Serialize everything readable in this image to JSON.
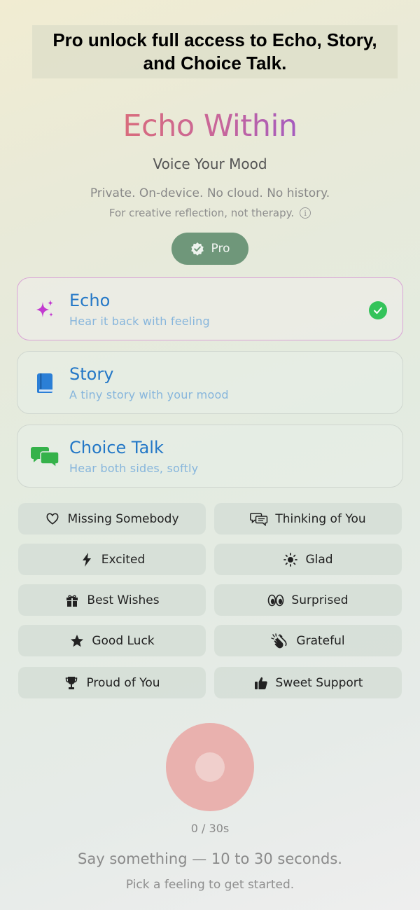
{
  "banner": {
    "text": "Pro unlock full access to Echo, Story, and Choice Talk."
  },
  "header": {
    "title": "Echo Within",
    "subtitle": "Voice Your Mood",
    "privacy": "Private. On-device. No cloud. No history.",
    "disclaimer": "For creative reflection, not therapy.",
    "pro_label": "Pro"
  },
  "modes": [
    {
      "title": "Echo",
      "description": "Hear it back with feeling",
      "icon": "sparkles-icon",
      "selected": true
    },
    {
      "title": "Story",
      "description": "A tiny story with your mood",
      "icon": "book-icon",
      "selected": false
    },
    {
      "title": "Choice Talk",
      "description": "Hear both sides, softly",
      "icon": "chat-bubbles-icon",
      "selected": false
    }
  ],
  "feelings": [
    {
      "label": "Missing Somebody",
      "icon": "heart-icon"
    },
    {
      "label": "Thinking of You",
      "icon": "message-bubbles-icon"
    },
    {
      "label": "Excited",
      "icon": "bolt-icon"
    },
    {
      "label": "Glad",
      "icon": "sun-icon"
    },
    {
      "label": "Best Wishes",
      "icon": "gift-icon"
    },
    {
      "label": "Surprised",
      "icon": "eyes-icon"
    },
    {
      "label": "Good Luck",
      "icon": "star-icon"
    },
    {
      "label": "Grateful",
      "icon": "hands-clap-icon"
    },
    {
      "label": "Proud of You",
      "icon": "trophy-icon"
    },
    {
      "label": "Sweet Support",
      "icon": "thumbs-up-icon"
    }
  ],
  "recorder": {
    "timer": "0 / 30s",
    "prompt": "Say something — 10 to 30 seconds.",
    "hint": "Pick a feeling to get started."
  },
  "colors": {
    "accent_blue": "#2478c7",
    "pro_green": "#6f977a",
    "check_green": "#34c35a",
    "record_red": "#e9b1ae",
    "selected_border": "#d9a4d6"
  }
}
